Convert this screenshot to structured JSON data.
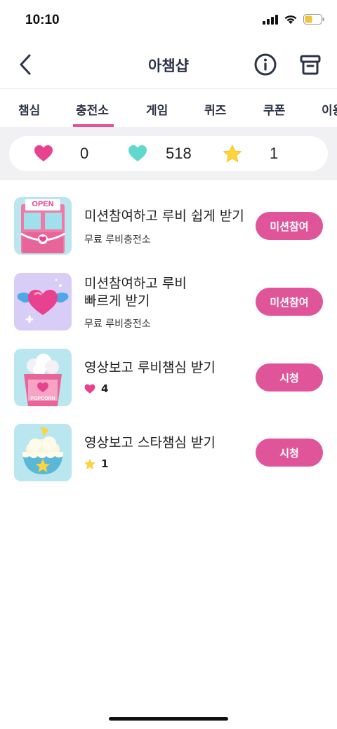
{
  "status": {
    "time": "10:10"
  },
  "nav": {
    "title": "아챔샵"
  },
  "tabs": [
    {
      "label": "챔심"
    },
    {
      "label": "충전소"
    },
    {
      "label": "게임"
    },
    {
      "label": "퀴즈"
    },
    {
      "label": "쿠폰"
    },
    {
      "label": "이용"
    }
  ],
  "active_tab": "충전소",
  "balance": {
    "heart": "0",
    "ruby": "518",
    "star": "1"
  },
  "items": [
    {
      "title": "미션참여하고 루비 쉽게 받기",
      "subtitle": "무료 루비충전소",
      "button": "미션참여",
      "thumb_text": "OPEN"
    },
    {
      "title_line1": "미션참여하고 루비",
      "title_line2": "빠르게 받기",
      "subtitle": "무료 루비충전소",
      "button": "미션참여"
    },
    {
      "title": "영상보고 루비챔심 받기",
      "reward_value": "4",
      "reward_icon": "heart-icon",
      "button": "시청",
      "thumb_text": "POPCORN"
    },
    {
      "title": "영상보고 스타챔심 받기",
      "reward_value": "1",
      "reward_icon": "star-icon",
      "button": "시청"
    }
  ],
  "colors": {
    "accent": "#e0559a",
    "heart": "#e8428f",
    "ruby": "#5fd9cc",
    "star": "#ffd43b"
  }
}
